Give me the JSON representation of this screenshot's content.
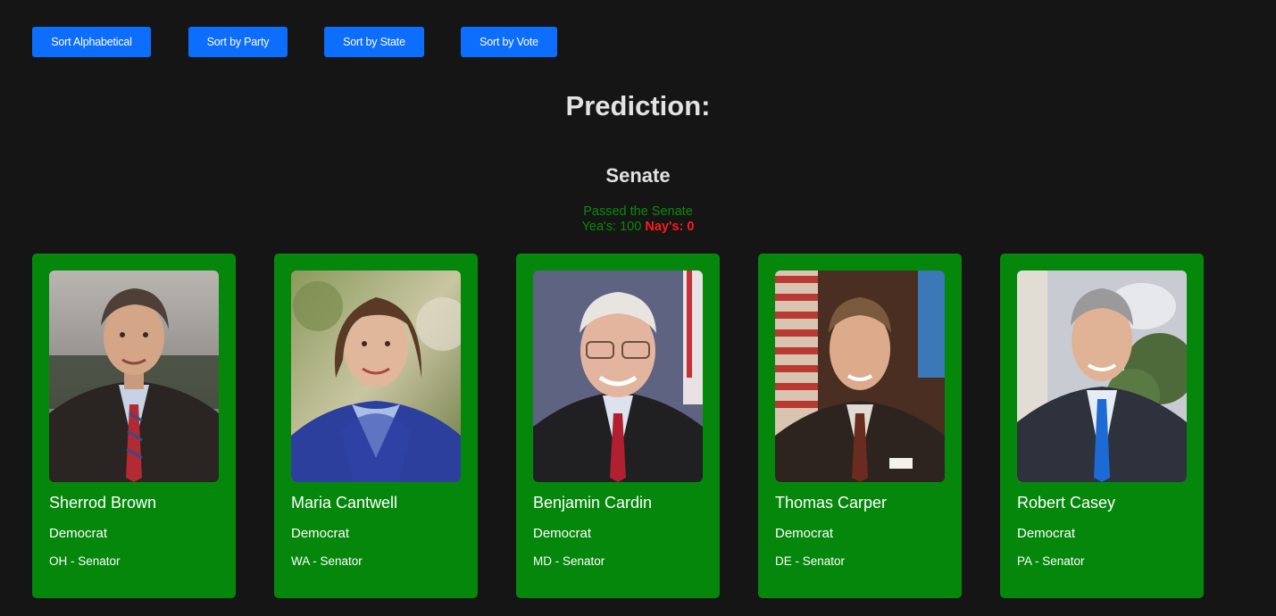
{
  "toolbar": {
    "sort_alphabetical": "Sort Alphabetical",
    "sort_party": "Sort by Party",
    "sort_state": "Sort by State",
    "sort_vote": "Sort by Vote"
  },
  "page_title": "Prediction:",
  "chamber": {
    "title": "Senate",
    "status": "Passed the Senate",
    "yea_label": "Yea's: 100",
    "nay_label": "Nay's: 0"
  },
  "colors": {
    "background": "#151515",
    "button": "#0d6efd",
    "card": "#05870b",
    "yea_text": "#0a8a0a",
    "nay_text": "#ff1a1a"
  },
  "senators": [
    {
      "name": "Sherrod Brown",
      "party": "Democrat",
      "state": "OH - Senator"
    },
    {
      "name": "Maria Cantwell",
      "party": "Democrat",
      "state": "WA - Senator"
    },
    {
      "name": "Benjamin Cardin",
      "party": "Democrat",
      "state": "MD - Senator"
    },
    {
      "name": "Thomas Carper",
      "party": "Democrat",
      "state": "DE - Senator"
    },
    {
      "name": "Robert Casey",
      "party": "Democrat",
      "state": "PA - Senator"
    }
  ]
}
